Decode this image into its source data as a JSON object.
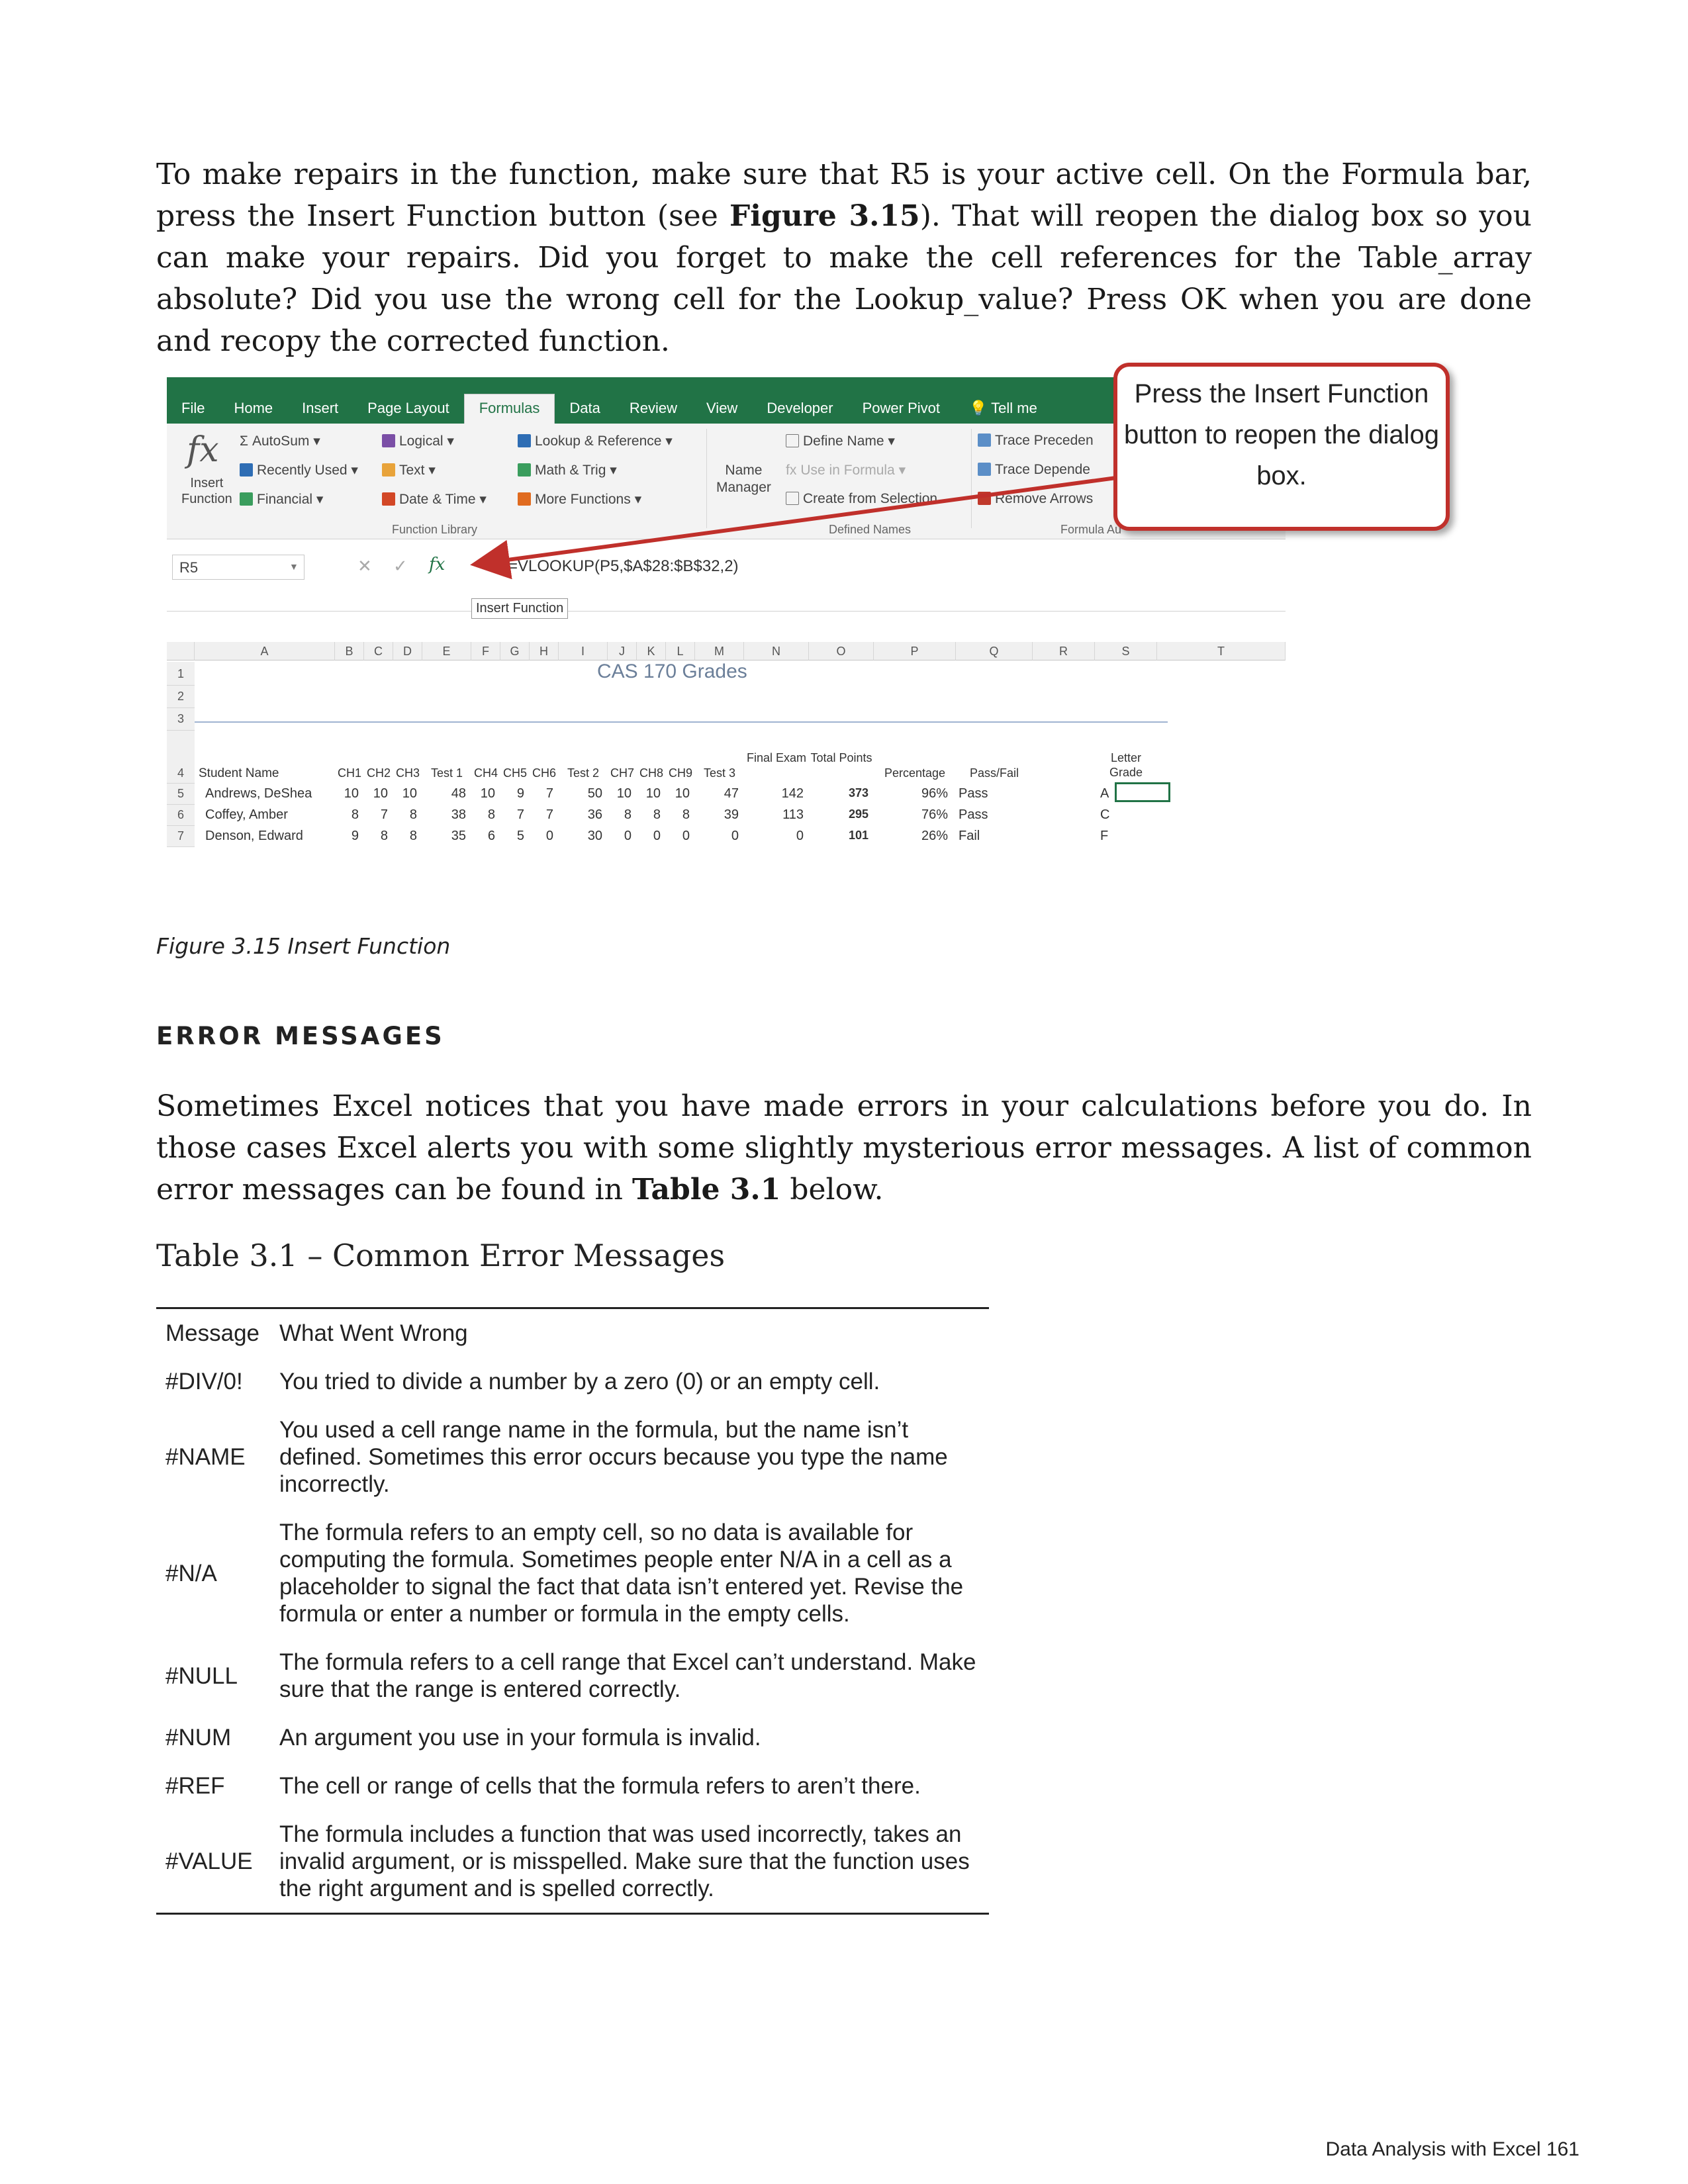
{
  "paragraph1": {
    "part1": "To make repairs in the function, make sure that R5 is your active cell. On the Formula bar, press the Insert Function button (see ",
    "bold": "Figure 3.15",
    "part2": "). That will reopen the dialog box so you can make your repairs. Did you forget to make the cell references for the Table_array absolute? Did you use the wrong cell for the Lookup_value? Press OK when you are done and recopy the corrected function."
  },
  "figure": {
    "tabs": [
      "File",
      "Home",
      "Insert",
      "Page Layout",
      "Formulas",
      "Data",
      "Review",
      "View",
      "Developer",
      "Power Pivot",
      "Tell me"
    ],
    "active_tab": "Formulas",
    "ribbon": {
      "insert_function": [
        "Insert",
        "Function"
      ],
      "library": [
        "AutoSum",
        "Recently Used",
        "Financial",
        "Logical",
        "Text",
        "Date & Time",
        "Lookup & Reference",
        "Math & Trig",
        "More Functions"
      ],
      "library_label": "Function Library",
      "name_manager": [
        "Name",
        "Manager"
      ],
      "defined": [
        "Define Name",
        "Use in Formula",
        "Create from Selection"
      ],
      "defined_label": "Defined Names",
      "auditing": [
        "Trace Preceden",
        "Trace Depende",
        "Remove Arrows"
      ],
      "auditing_label": "Formula Au"
    },
    "name_box": "R5",
    "formula": "=VLOOKUP(P5,$A$28:$B$32,2)",
    "tooltip": "Insert Function",
    "columns": [
      "A",
      "B",
      "C",
      "D",
      "E",
      "F",
      "G",
      "H",
      "I",
      "J",
      "K",
      "L",
      "M",
      "N",
      "O",
      "P",
      "Q",
      "R",
      "S",
      "T"
    ],
    "sheet_title": "CAS 170 Grades",
    "headers": [
      "Student Name",
      "CH1",
      "CH2",
      "CH3",
      "Test 1",
      "CH4",
      "CH5",
      "CH6",
      "Test 2",
      "CH7",
      "CH8",
      "CH9",
      "Test 3",
      "Final Exam",
      "Total Points",
      "Percentage",
      "Pass/Fail",
      "Letter Grade"
    ],
    "rows": [
      {
        "num": "5",
        "name": "Andrews, DeShea",
        "vals": [
          "10",
          "10",
          "10",
          "48",
          "10",
          "9",
          "7",
          "50",
          "10",
          "10",
          "10",
          "47",
          "142",
          "373",
          "96%",
          "Pass",
          "A"
        ]
      },
      {
        "num": "6",
        "name": "Coffey, Amber",
        "vals": [
          "8",
          "7",
          "8",
          "38",
          "8",
          "7",
          "7",
          "36",
          "8",
          "8",
          "8",
          "39",
          "113",
          "295",
          "76%",
          "Pass",
          "C"
        ]
      },
      {
        "num": "7",
        "name": "Denson, Edward",
        "vals": [
          "9",
          "8",
          "8",
          "35",
          "6",
          "5",
          "0",
          "30",
          "0",
          "0",
          "0",
          "0",
          "0",
          "101",
          "26%",
          "Fail",
          "F"
        ]
      }
    ],
    "row_numbers": [
      "1",
      "2",
      "3",
      "4"
    ],
    "callout": "Press the Insert Function button to reopen the dialog box."
  },
  "caption": "Figure 3.15 Insert Function",
  "heading": "ERROR MESSAGES",
  "paragraph2": {
    "part1": "Sometimes Excel notices that you have made errors in your calculations before you do. In those cases Excel alerts you with some slightly mysterious error messages. A list of common error messages can be found in ",
    "bold": "Table 3.1",
    "part2": " below."
  },
  "table": {
    "title": "Table 3.1 – Common Error Messages",
    "headers": [
      "Message",
      "What Went Wrong"
    ],
    "rows": [
      [
        "#DIV/0!",
        "You tried to divide a number by a zero (0) or an empty cell."
      ],
      [
        "#NAME",
        "You used a cell range name in the formula, but the name isn’t defined. Sometimes this error occurs because you type the name incorrectly."
      ],
      [
        "#N/A",
        "The formula refers to an empty cell, so no data is available for computing the formula. Sometimes people enter N/A in a cell as a placeholder to signal the fact that data isn’t entered yet. Revise the formula or enter a number or formula in the empty cells."
      ],
      [
        "#NULL",
        "The formula refers to a cell range that Excel can’t understand. Make sure that the range is entered correctly."
      ],
      [
        "#NUM",
        "An argument you use in your formula is invalid."
      ],
      [
        "#REF",
        "The cell or range of cells that the formula refers to aren’t there."
      ],
      [
        "#VALUE",
        "The formula includes a function that was used incorrectly, takes an invalid argument, or is misspelled. Make sure that the function uses the right argument and is spelled correctly."
      ]
    ]
  },
  "footer": "Data Analysis with Excel 161",
  "colors": {
    "excel_green": "#217346",
    "callout_red": "#c0302b"
  }
}
